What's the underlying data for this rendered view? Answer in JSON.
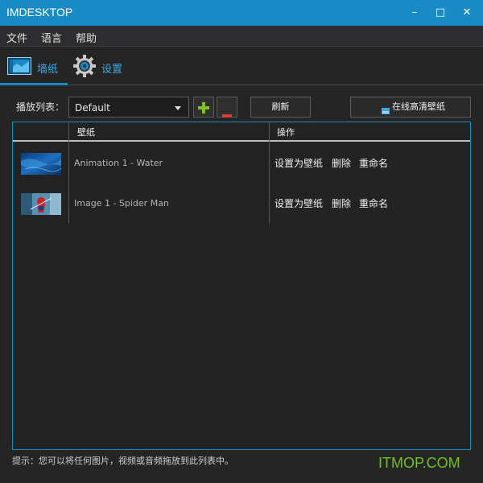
{
  "window": {
    "title": "IMDESKTOP",
    "controls": {
      "minimize": "–",
      "maximize": "□",
      "close": "✕"
    }
  },
  "menu": {
    "items": [
      "文件",
      "语言",
      "帮助"
    ]
  },
  "tabs": [
    {
      "label": "墙纸",
      "icon": "wallpaper-icon",
      "active": true
    },
    {
      "label": "设置",
      "icon": "gear-icon",
      "active": false
    }
  ],
  "toolbar": {
    "playlist_label": "播放列表：",
    "playlist_value": "Default",
    "add_icon": "plus-icon",
    "remove_icon": "minus-icon",
    "refresh_label": "刷新",
    "online_label": "在线高清壁纸"
  },
  "table": {
    "headers": {
      "wallpaper": "壁纸",
      "actions": "操作"
    },
    "rows": [
      {
        "name": "Animation 1 - Water",
        "thumb": "water-thumbnail",
        "actions": [
          "设置为壁纸",
          "删除",
          "重命名"
        ]
      },
      {
        "name": "Image 1 - Spider Man",
        "thumb": "spiderman-thumbnail",
        "actions": [
          "设置为壁纸",
          "删除",
          "重命名"
        ]
      }
    ]
  },
  "hint": "提示：您可以将任何图片，视频或音频拖放到此列表中。",
  "watermark": "ITMOP.COM",
  "colors": {
    "accent": "#1a8ac4",
    "background": "#252526",
    "add_green": "#7cc32b",
    "remove_red": "#d43f3a",
    "watermark_green": "#6fbf2a"
  }
}
